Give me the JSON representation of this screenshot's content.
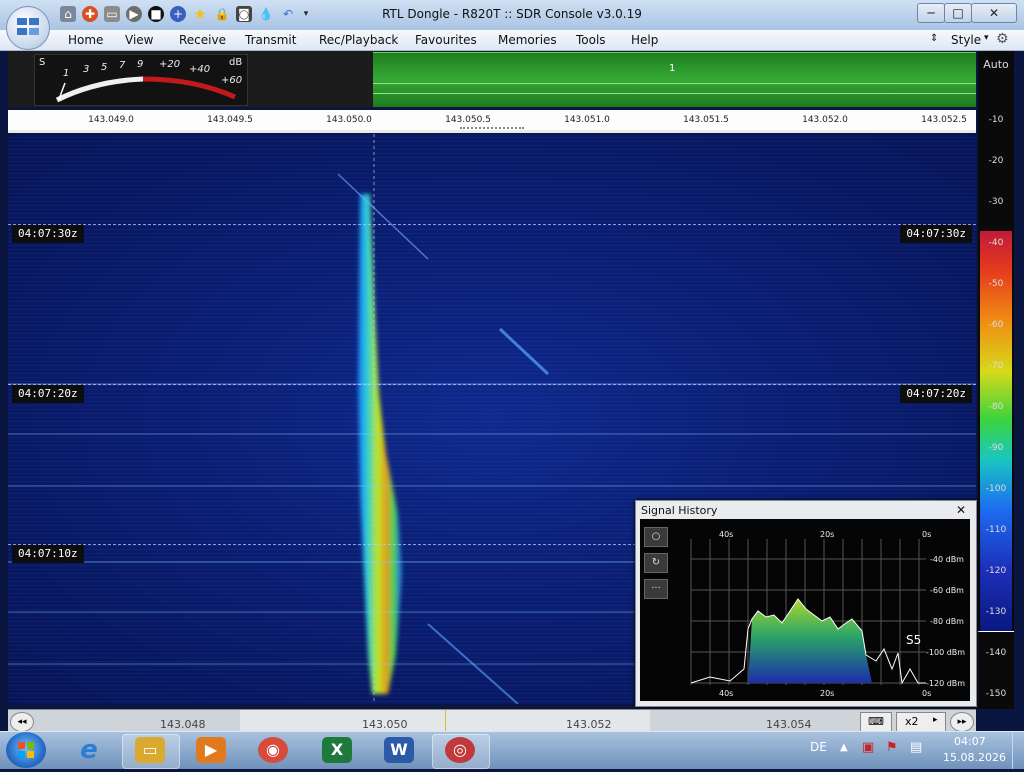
{
  "window": {
    "title": "RTL Dongle - R820T :: SDR Console v3.0.19",
    "controls": {
      "minimize": "─",
      "maximize": "□",
      "close": "✕"
    }
  },
  "quick_access_icons": [
    "home-icon",
    "lifebuoy-icon",
    "folder-icon",
    "play-icon",
    "stop-icon",
    "plus-icon",
    "star-icon",
    "lock-icon",
    "camera-icon",
    "drop-icon",
    "undo-icon",
    "dropdown-icon"
  ],
  "menu": {
    "items": [
      "Home",
      "View",
      "Receive",
      "Transmit",
      "Rec/Playback",
      "Favourites",
      "Memories",
      "Tools",
      "Help"
    ],
    "style_label": "Style"
  },
  "smeter": {
    "s_label": "S",
    "db_label": "dB",
    "scale": [
      "1",
      "3",
      "5",
      "7",
      "9",
      "+20",
      "+40",
      "+60"
    ]
  },
  "vfo_marker": "1",
  "frequency_ruler": [
    "143.049.0",
    "143.049.5",
    "143.050.0",
    "143.050.5",
    "143.051.0",
    "143.051.5",
    "143.052.0",
    "143.052.5"
  ],
  "waterfall": {
    "timestamps": [
      "04:07:30z",
      "04:07:20z",
      "04:07:10z"
    ]
  },
  "level_scale": {
    "auto_label": "Auto",
    "ticks": [
      "-10",
      "-20",
      "-30",
      "-40",
      "-50",
      "-60",
      "-70",
      "-80",
      "-90",
      "-100",
      "-110",
      "-120",
      "-130",
      "-140",
      "-150"
    ]
  },
  "signal_history": {
    "title": "Signal History",
    "close": "✕",
    "time_top": [
      "40s",
      "20s",
      "0s"
    ],
    "time_bottom": [
      "40s",
      "20s",
      "0s"
    ],
    "dbm": [
      "-40 dBm",
      "-60 dBm",
      "-80 dBm",
      "-100 dBm",
      "-120 dBm"
    ],
    "s_reading": "S5",
    "buttons": [
      "○",
      "↻",
      "···"
    ]
  },
  "bottom_scale": [
    "143.048",
    "143.050",
    "143.052",
    "143.054"
  ],
  "bottom_controls": {
    "zoom": "x2"
  },
  "taskbar": {
    "lang": "DE",
    "time": "04:07",
    "date": "15.08.2026",
    "apps": [
      {
        "name": "internet-explorer",
        "glyph": "e",
        "color": "#2a7fd4"
      },
      {
        "name": "file-explorer",
        "glyph": "▭",
        "color": "#d9a930"
      },
      {
        "name": "media-player",
        "glyph": "▶",
        "color": "#e07a1e"
      },
      {
        "name": "chrome",
        "glyph": "◉",
        "color": "#d84b3a"
      },
      {
        "name": "excel",
        "glyph": "X",
        "color": "#1e7a3c"
      },
      {
        "name": "word",
        "glyph": "W",
        "color": "#2b5aa8"
      },
      {
        "name": "sdr-console",
        "glyph": "◎",
        "color": "#c0393b"
      }
    ]
  }
}
